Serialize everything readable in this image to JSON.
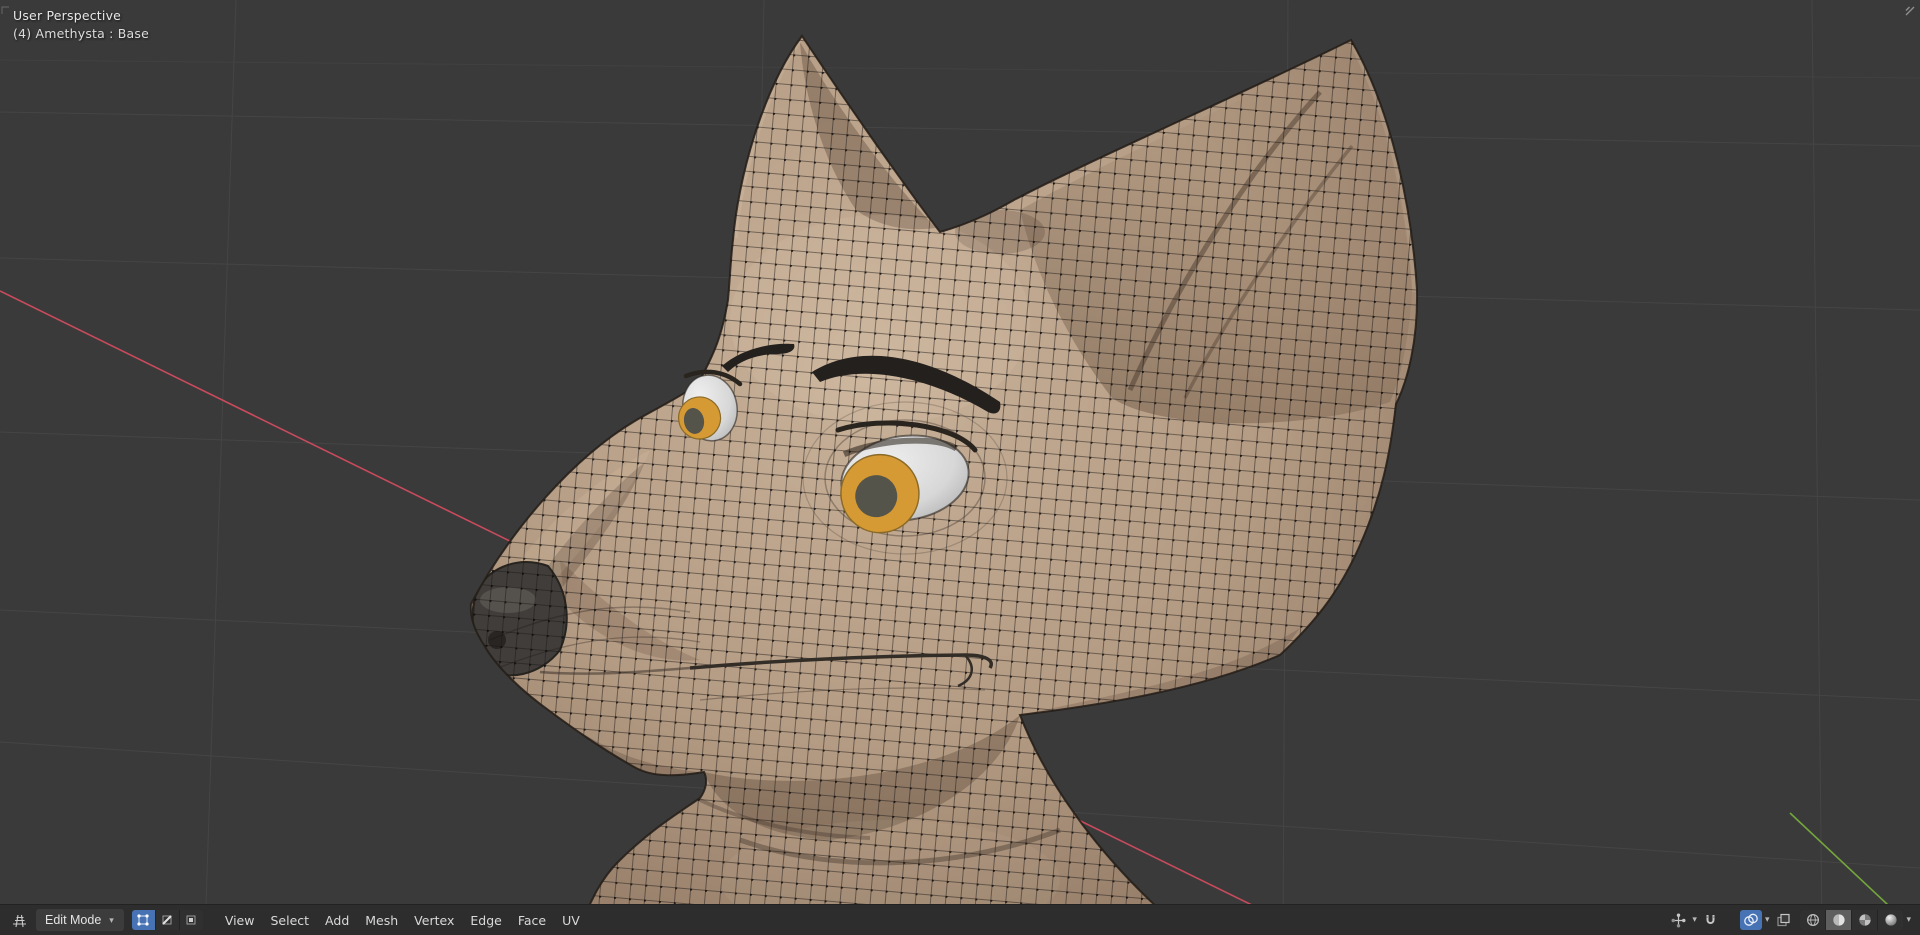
{
  "viewport": {
    "perspective_label": "User Perspective",
    "object_label": "(4) Amethysta : Base"
  },
  "header": {
    "mode": "Edit Mode",
    "menus": [
      "View",
      "Select",
      "Add",
      "Mesh",
      "Vertex",
      "Edge",
      "Face",
      "UV"
    ]
  },
  "icons": {
    "chevron_down": "▾",
    "editor_type": "3d-viewport-editor-icon",
    "select_modes": [
      "vertex-select",
      "edge-select",
      "face-select"
    ],
    "right_cluster": [
      "show-gizmo",
      "snapping-magnet",
      "show-overlays",
      "toggle-xray",
      "wireframe-shading",
      "solid-shading",
      "material-preview-shading",
      "rendered-shading"
    ]
  },
  "colors": {
    "background": "#3a3a3a",
    "header_bg": "#2d2d2d",
    "accent_blue": "#4772b3",
    "axis_x_red": "#c84b5d",
    "axis_y_green": "#74a53d",
    "grid_line": "#454545",
    "model_light": "#c9b29a",
    "model_base": "#b49b83",
    "model_shadow": "#8a7360",
    "eye_sclera": "#dedede",
    "eye_iris": "#d59a33",
    "eye_pupil": "#55544a",
    "nose": "#403d3a",
    "wireframe": "#1c1814"
  }
}
